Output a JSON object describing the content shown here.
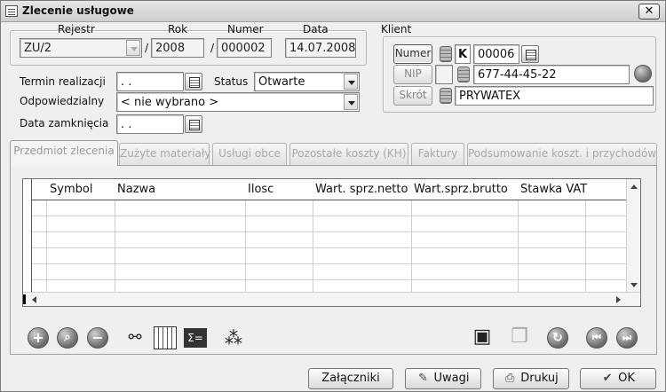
{
  "window": {
    "title": "Zlecenie usługowe",
    "close_glyph": "✕"
  },
  "header": {
    "rejestr_label": "Rejestr",
    "rok_label": "Rok",
    "numer_label": "Numer",
    "data_label": "Data",
    "rejestr_value": "ZU/2",
    "rok_value": "2008",
    "numer_value": "000002",
    "data_value": "14.07.2008",
    "slash": "/"
  },
  "klient": {
    "label": "Klient",
    "numer_button": "Numer",
    "nip_button": "NIP",
    "skrot_button": "Skrót",
    "k_flag": "K",
    "numer_value": "00006",
    "nip_value": "677-44-45-22",
    "skrot_value": "PRYWATEX"
  },
  "form": {
    "termin_label": "Termin realizacji",
    "termin_value": "  .  .",
    "status_label": "Status",
    "status_value": "Otwarte",
    "odpowiedzialny_label": "Odpowiedzialny",
    "odpowiedzialny_value": "< nie wybrano >",
    "data_zamkniecia_label": "Data zamknięcia",
    "data_zamkniecia_value": "  .  ."
  },
  "tabs": [
    {
      "label": "Przedmiot zlecenia",
      "active": true
    },
    {
      "label": "Zużyte materiały"
    },
    {
      "label": "Usługi obce"
    },
    {
      "label": "Pozostałe koszty (KH)"
    },
    {
      "label": "Faktury"
    },
    {
      "label": "Podsumowanie koszt. i przychodów"
    }
  ],
  "grid": {
    "columns": [
      "Symbol",
      "Nazwa",
      "Ilosc",
      "Wart. sprz.netto",
      "Wart.sprz.brutto",
      "Stawka VAT"
    ]
  },
  "bottom_buttons": {
    "zalaczniki": "Załączniki",
    "uwagi": "Uwagi",
    "drukuj": "Drukuj",
    "ok": "OK"
  },
  "icons": [
    "plus-icon",
    "search-icon",
    "minus-icon",
    "binoculars-icon",
    "table-filter-icon",
    "sum-icon",
    "tree-icon",
    "save-icon",
    "copy-icon",
    "refresh-icon",
    "first-record-icon",
    "last-record-icon"
  ]
}
